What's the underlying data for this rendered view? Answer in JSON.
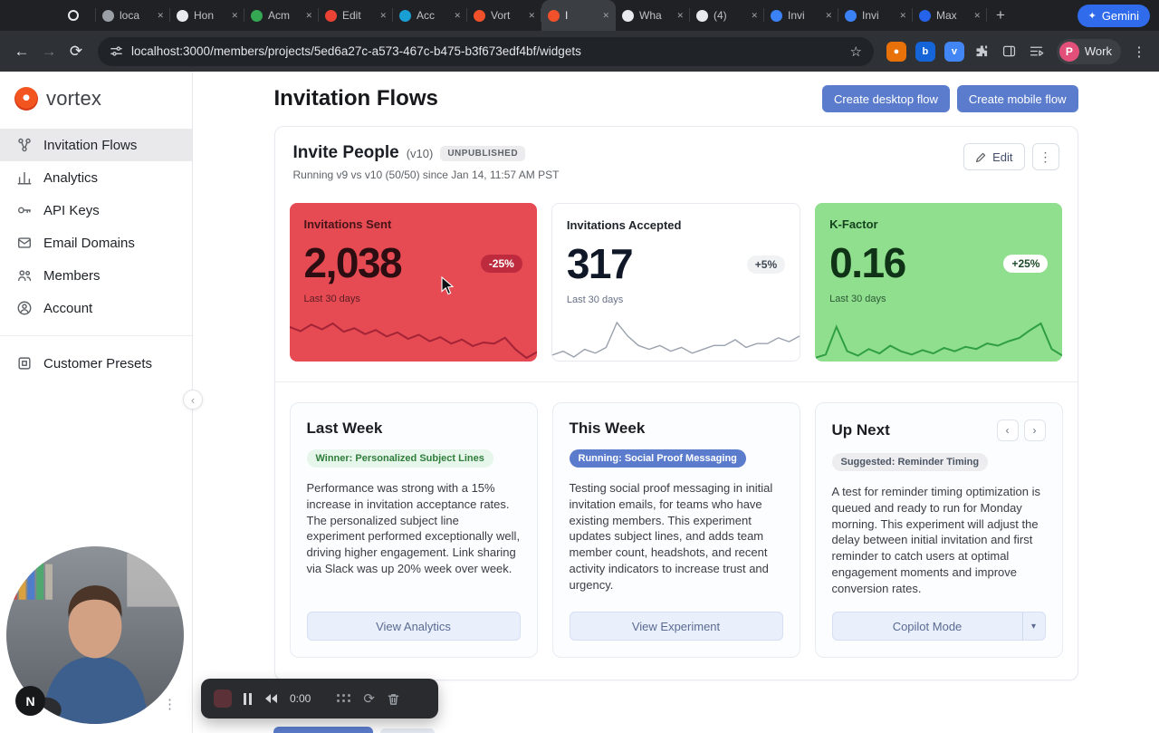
{
  "colors": {
    "accent_blue": "#5b7ccd",
    "metric_red": "#e64a52",
    "metric_red_badge": "#bf2b3e",
    "metric_green": "#90df8e",
    "gemini_blue": "#2f6bea",
    "sidebar_active": "#e9e9eb"
  },
  "browser": {
    "tabs": [
      {
        "label": "",
        "favicon_color": "#e8eaed",
        "kind": "record"
      },
      {
        "label": "loca",
        "favicon_color": "#9aa0a6"
      },
      {
        "label": "Hon",
        "favicon_color": "#e8eaed"
      },
      {
        "label": "Acm",
        "favicon_color": "#34a853"
      },
      {
        "label": "Edit",
        "favicon_color": "#ea4335"
      },
      {
        "label": "Acc",
        "favicon_color": "#1a9fd4"
      },
      {
        "label": "Vort",
        "favicon_color": "#f0512b"
      },
      {
        "label": "I",
        "favicon_color": "#f0512b",
        "active": true
      },
      {
        "label": "Wha",
        "favicon_color": "#e8eaed"
      },
      {
        "label": "(4)",
        "favicon_color": "#e8eaed"
      },
      {
        "label": "Invi",
        "favicon_color": "#3b82f6"
      },
      {
        "label": "Invi",
        "favicon_color": "#3b82f6"
      },
      {
        "label": "Max",
        "favicon_color": "#2563eb"
      }
    ],
    "new_tab_label": "+",
    "gemini_label": "Gemini",
    "url": "localhost:3000/members/projects/5ed6a27c-a573-467c-b475-b3f673edf4bf/widgets",
    "profile": {
      "initial": "P",
      "label": "Work"
    }
  },
  "sidebar": {
    "logo_text": "vortex",
    "items": [
      {
        "label": "Invitation Flows",
        "active": true
      },
      {
        "label": "Analytics"
      },
      {
        "label": "API Keys"
      },
      {
        "label": "Email Domains"
      },
      {
        "label": "Members"
      },
      {
        "label": "Account"
      }
    ],
    "preset_label": "Customer Presets"
  },
  "page": {
    "title": "Invitation Flows",
    "actions": [
      {
        "label": "Create desktop flow"
      },
      {
        "label": "Create mobile flow"
      }
    ]
  },
  "flow_card": {
    "title": "Invite People",
    "version": "(v10)",
    "status": "UNPUBLISHED",
    "subtitle": "Running v9 vs v10 (50/50) since Jan 14, 11:57 AM PST",
    "edit_label": "Edit"
  },
  "metrics": [
    {
      "title": "Invitations Sent",
      "value": "2,038",
      "delta": "-25%",
      "period": "Last 30 days"
    },
    {
      "title": "Invitations Accepted",
      "value": "317",
      "delta": "+5%",
      "period": "Last 30 days"
    },
    {
      "title": "K-Factor",
      "value": "0.16",
      "delta": "+25%",
      "period": "Last 30 days"
    }
  ],
  "insights": [
    {
      "title": "Last Week",
      "badge": "Winner: Personalized Subject Lines",
      "body": "Performance was strong with a 15% increase in invitation acceptance rates. The personalized subject line experiment performed exceptionally well, driving higher engagement. Link sharing via Slack was up 20% week over week.",
      "button": "View Analytics"
    },
    {
      "title": "This Week",
      "badge": "Running: Social Proof Messaging",
      "body": "Testing social proof messaging in initial invitation emails, for teams who have existing members. This experiment updates subject lines, and adds team member count, headshots, and recent activity indicators to increase trust and urgency.",
      "button": "View Experiment"
    },
    {
      "title": "Up Next",
      "badge": "Suggested: Reminder Timing",
      "body": "A test for reminder timing optimization is queued and ready to run for Monday morning. This experiment will adjust the delay between initial invitation and first reminder to catch users at optimal engagement moments and improve conversion rates.",
      "button": "Copilot Mode"
    }
  ],
  "recorder": {
    "time": "0:00"
  },
  "webcam": {
    "initial": "N"
  },
  "chart_data": [
    {
      "type": "line",
      "title": "Invitations Sent - last 30 days sparkline",
      "color": "#a32337",
      "values": [
        62,
        55,
        66,
        58,
        68,
        54,
        60,
        50,
        57,
        46,
        53,
        42,
        49,
        38,
        45,
        34,
        41,
        30,
        36,
        34,
        44,
        24,
        10,
        20
      ]
    },
    {
      "type": "line",
      "title": "Invitations Accepted - last 30 days sparkline",
      "color": "#9aa2ad",
      "values": [
        18,
        22,
        16,
        24,
        20,
        26,
        52,
        38,
        28,
        24,
        28,
        22,
        26,
        20,
        24,
        28,
        28,
        34,
        26,
        30,
        30,
        36,
        32,
        38
      ]
    },
    {
      "type": "line",
      "title": "K-Factor - last 30 days sparkline",
      "color": "#2f9e44",
      "values": [
        22,
        28,
        78,
        34,
        26,
        38,
        30,
        44,
        34,
        28,
        36,
        30,
        40,
        34,
        42,
        38,
        48,
        44,
        52,
        58,
        72,
        84,
        38,
        26
      ]
    }
  ]
}
